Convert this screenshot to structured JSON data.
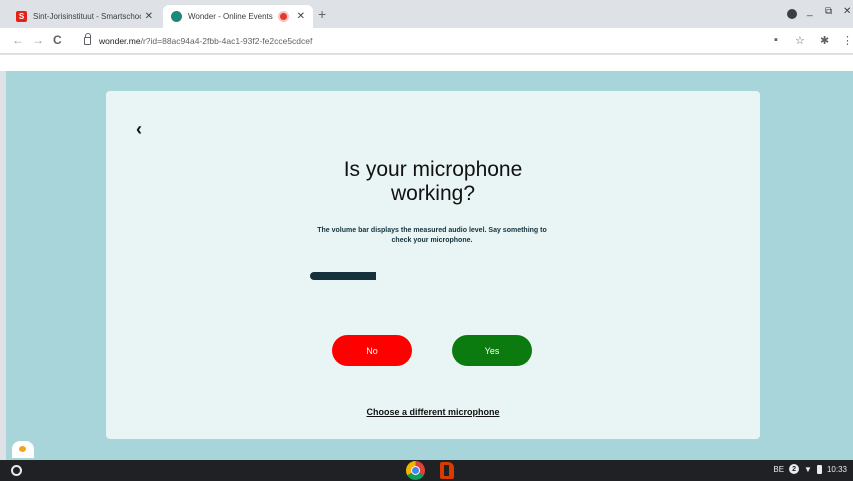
{
  "browser": {
    "tabs": [
      {
        "favicon_letter": "S",
        "title": "Sint-Jorisinstituut - Smartschool",
        "close": "✕"
      },
      {
        "title": "Wonder - Online Events",
        "close": "✕"
      }
    ],
    "new_tab": "+",
    "window_controls": {
      "minimize": "_",
      "restore": "⧉",
      "close": "✕"
    },
    "nav": {
      "back": "←",
      "forward": "→",
      "reload": "C"
    },
    "url": {
      "host": "wonder.me",
      "rest": "/r?id=88ac94a4-2fbb-4ac1-93f2-fe2cce5cdcef"
    },
    "toolbar_icons": {
      "camera": "▪",
      "star": "☆",
      "extensions": "✱",
      "menu": "⋮"
    }
  },
  "dialog": {
    "back": "‹",
    "title": "Is your microphone working?",
    "description": "The volume bar displays the measured audio level. Say something to check your microphone.",
    "volume_level": 0.27,
    "no_label": "No",
    "yes_label": "Yes",
    "change_mic_link": "Choose a different microphone"
  },
  "shelf": {
    "keyboard": "BE",
    "notifications": "2",
    "time": "10:33"
  },
  "colors": {
    "no_button": "#ff0000",
    "yes_button": "#0b7a0f",
    "page_background": "#a8d5da",
    "card_background": "#e9f5f4"
  }
}
